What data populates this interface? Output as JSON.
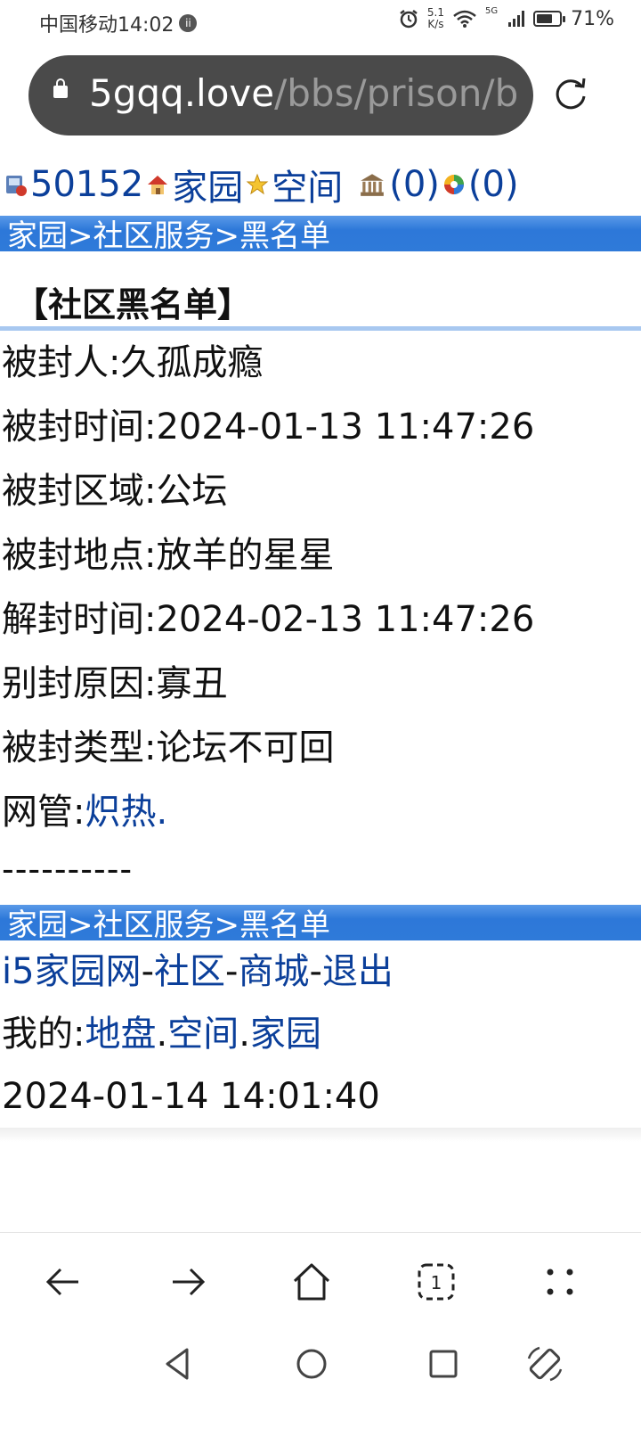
{
  "status_bar": {
    "carrier_time": "中国移动14:02",
    "badge": "ii",
    "speed_value": "5.1",
    "speed_unit": "K/s",
    "network": "5G",
    "battery": "71%",
    "battery_level": 0.71
  },
  "browser": {
    "url_host": "5gqq.love",
    "url_path": "/bbs/prison/b"
  },
  "top_links": {
    "user_id": "50152",
    "home": "家园",
    "space": "空间",
    "bank_count": "(0)",
    "color_count": "(0)"
  },
  "breadcrumb": {
    "home": "家园",
    "sep1": ">",
    "community": "社区服务",
    "sep2": ">",
    "blacklist": "黑名单"
  },
  "page_title": "【社区黑名单】",
  "record": {
    "banned_person": "被封人:久孤成瘾",
    "ban_time": "被封时间:2024-01-13 11:47:26",
    "ban_area": "被封区域:公坛",
    "ban_location": "被封地点:放羊的星星",
    "unban_time": "解封时间:2024-02-13 11:47:26",
    "reason": "别封原因:寡丑",
    "ban_type": "被封类型:论坛不可回",
    "admin_label": "网管:",
    "admin_name": "炽热."
  },
  "divider": "----------",
  "footer": {
    "site": "i5家园网",
    "dash1": "-",
    "community": "社区",
    "dash2": "-",
    "mall": "商城",
    "dash3": "-",
    "logout": "退出",
    "mine_label": "我的:",
    "territory": "地盘",
    "dot1": ".",
    "space": "空间",
    "dot2": ".",
    "home": "家园",
    "timestamp": "2024-01-14 14:01:40"
  },
  "nav": {
    "tab_count": "1"
  },
  "icons": {
    "back": "back-arrow-icon",
    "forward": "forward-arrow-icon",
    "home": "home-icon",
    "tabs": "tabs-icon",
    "menu": "menu-dots-icon"
  }
}
